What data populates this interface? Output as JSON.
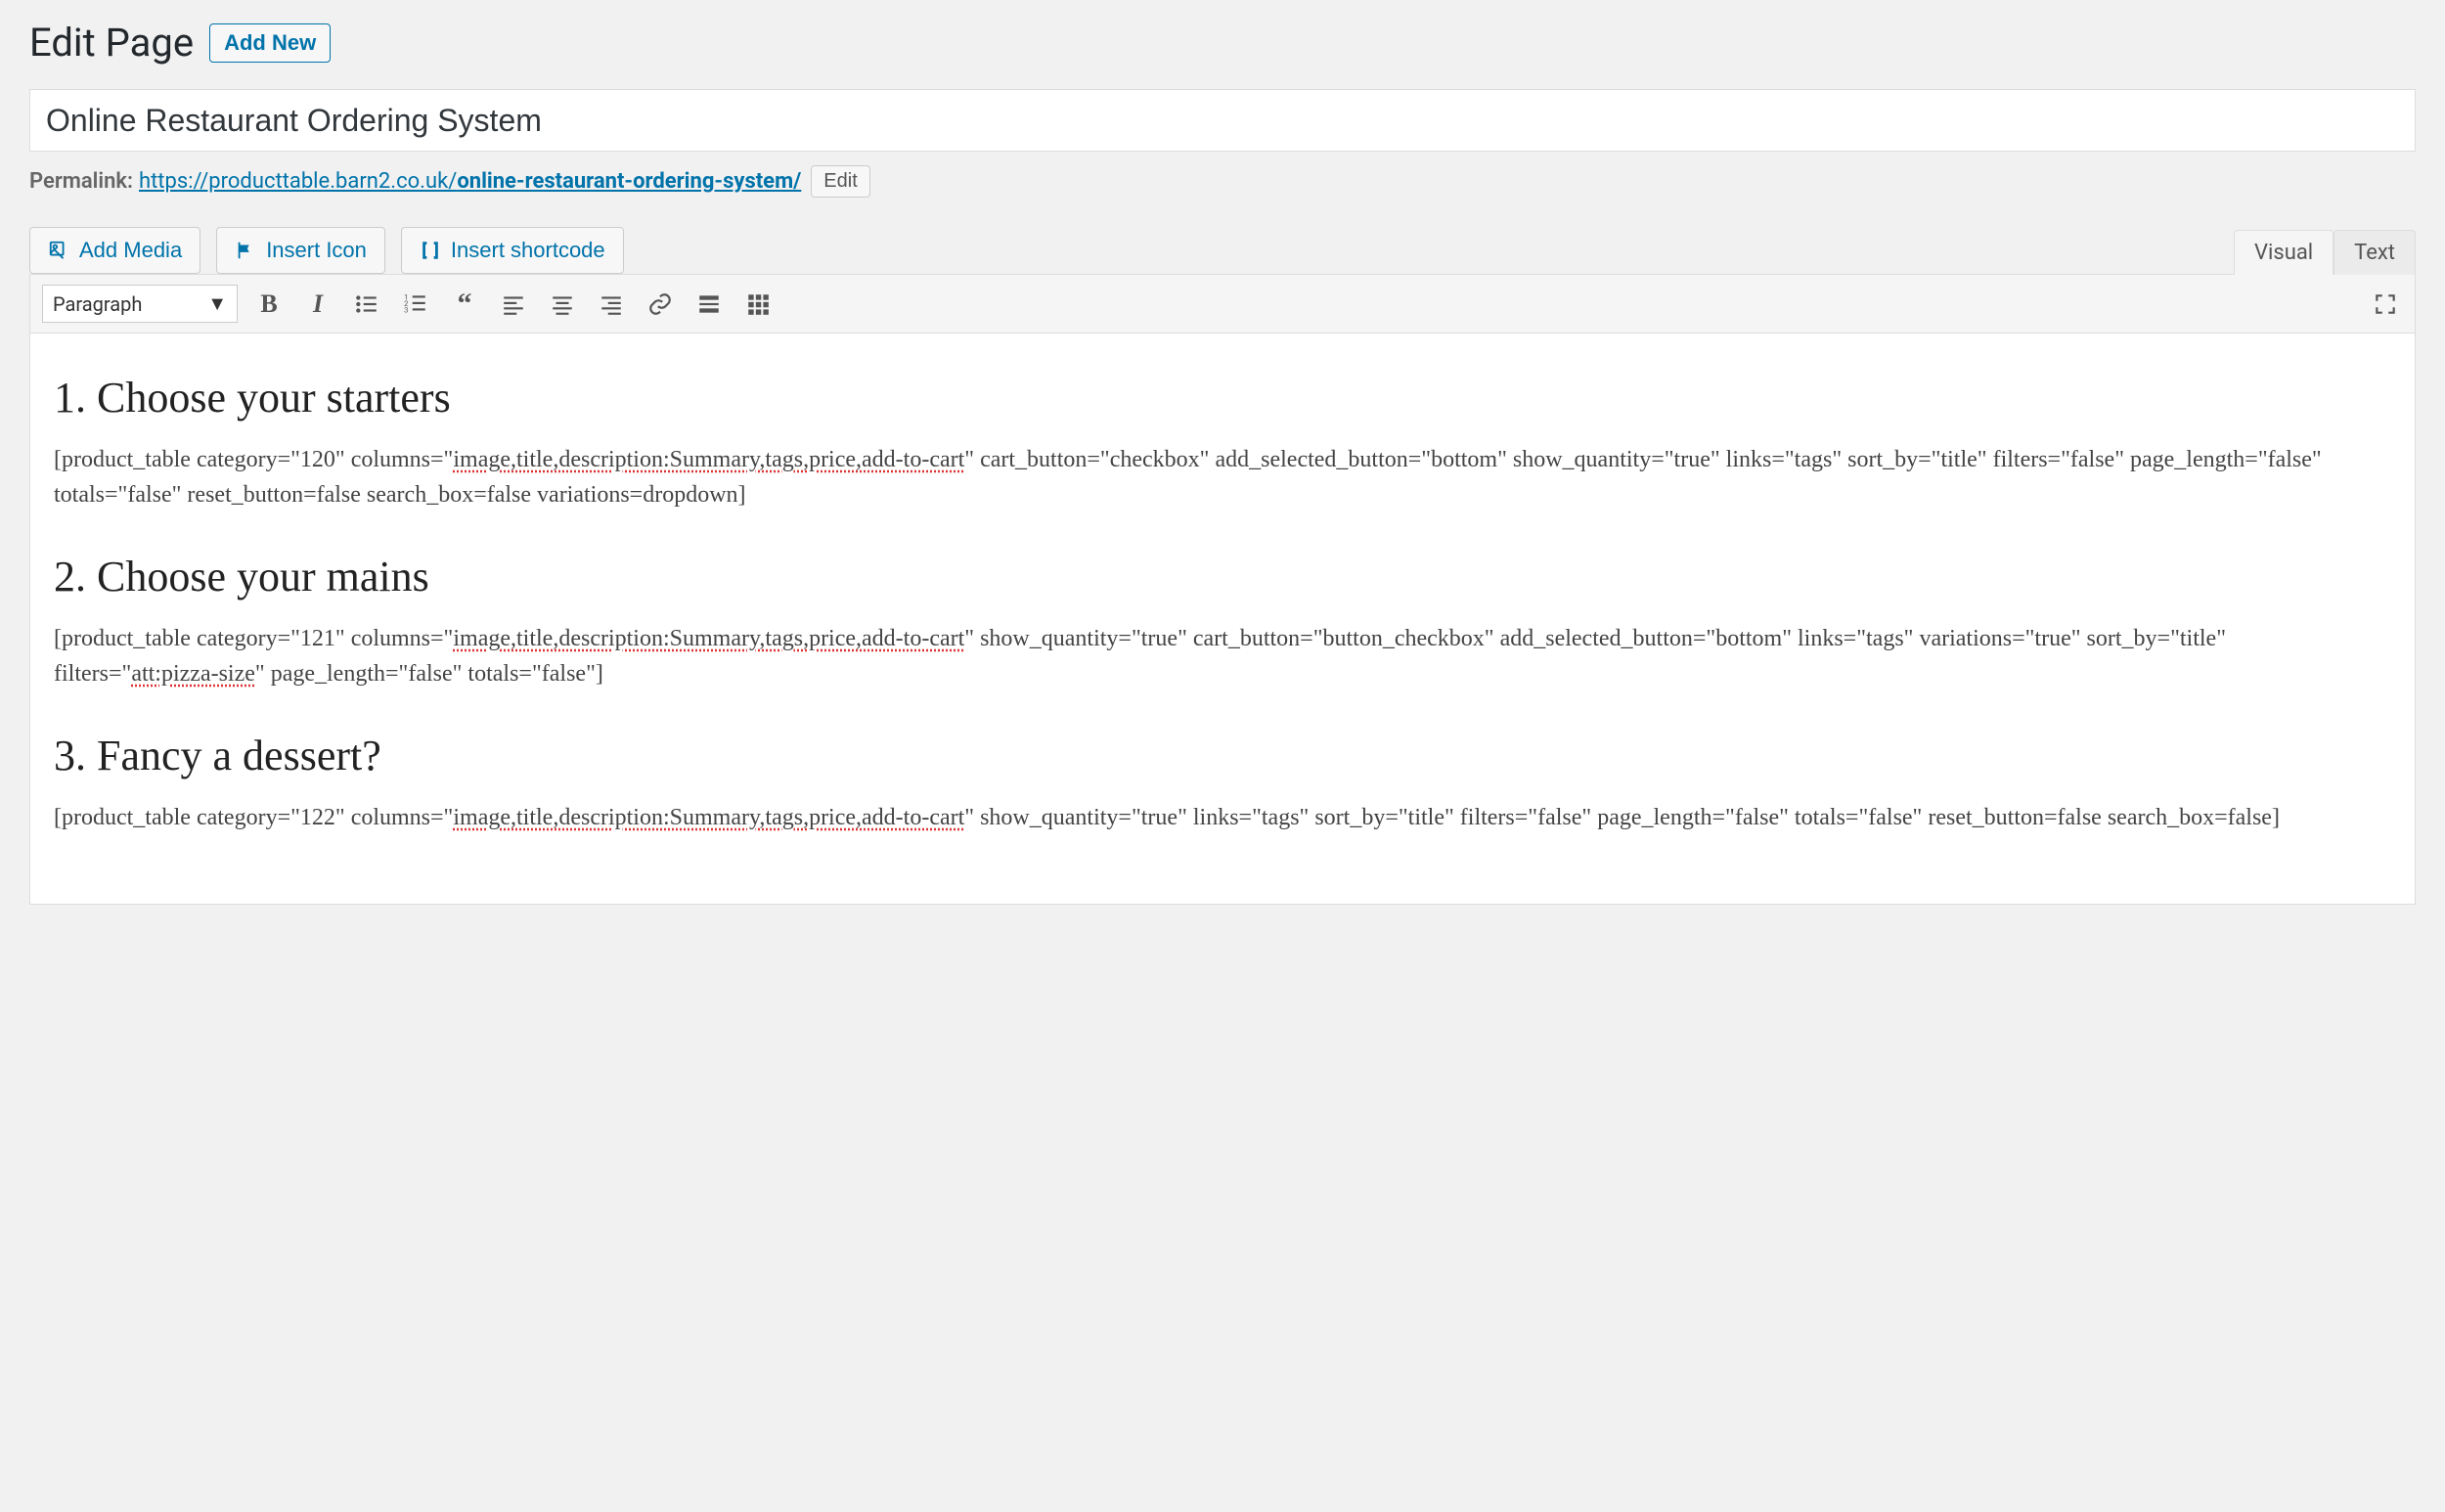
{
  "page": {
    "heading": "Edit Page",
    "add_new_label": "Add New",
    "title_value": "Online Restaurant Ordering System",
    "permalink_label": "Permalink:",
    "permalink_base": "https://producttable.barn2.co.uk/",
    "permalink_slug": "online-restaurant-ordering-system/",
    "permalink_edit": "Edit"
  },
  "media_buttons": {
    "add_media": "Add Media",
    "insert_icon": "Insert Icon",
    "insert_shortcode": "Insert shortcode"
  },
  "tabs": {
    "visual": "Visual",
    "text": "Text"
  },
  "toolbar": {
    "format_label": "Paragraph",
    "bold": "B",
    "italic": "I"
  },
  "content": {
    "h1": "1. Choose your starters",
    "p1a": "[product_table category=\"120\" columns=\"",
    "p1b": "image,title,description:Summary,tags,price,add-to-cart",
    "p1c": "\" cart_button=\"checkbox\" add_selected_button=\"bottom\" show_quantity=\"true\" links=\"tags\" sort_by=\"title\" filters=\"false\" page_length=\"false\" totals=\"false\" reset_button=false search_box=false variations=dropdown]",
    "h2": "2. Choose your mains",
    "p2a": "[product_table category=\"121\" columns=\"",
    "p2b": "image,title,description:Summary,tags,price,add-to-cart",
    "p2c": "\" show_quantity=\"true\" cart_button=\"button_checkbox\" add_selected_button=\"bottom\" links=\"tags\" variations=\"true\" sort_by=\"title\" filters=\"",
    "p2d": "att:pizza-size",
    "p2e": "\" page_length=\"false\" totals=\"false\"]",
    "h3": "3. Fancy a dessert?",
    "p3a": "[product_table category=\"122\" columns=\"",
    "p3b": "image,title,description:Summary,tags,price,add-to-cart",
    "p3c": "\" show_quantity=\"true\" links=\"tags\" sort_by=\"title\" filters=\"false\" page_length=\"false\" totals=\"false\" reset_button=false search_box=false]"
  }
}
